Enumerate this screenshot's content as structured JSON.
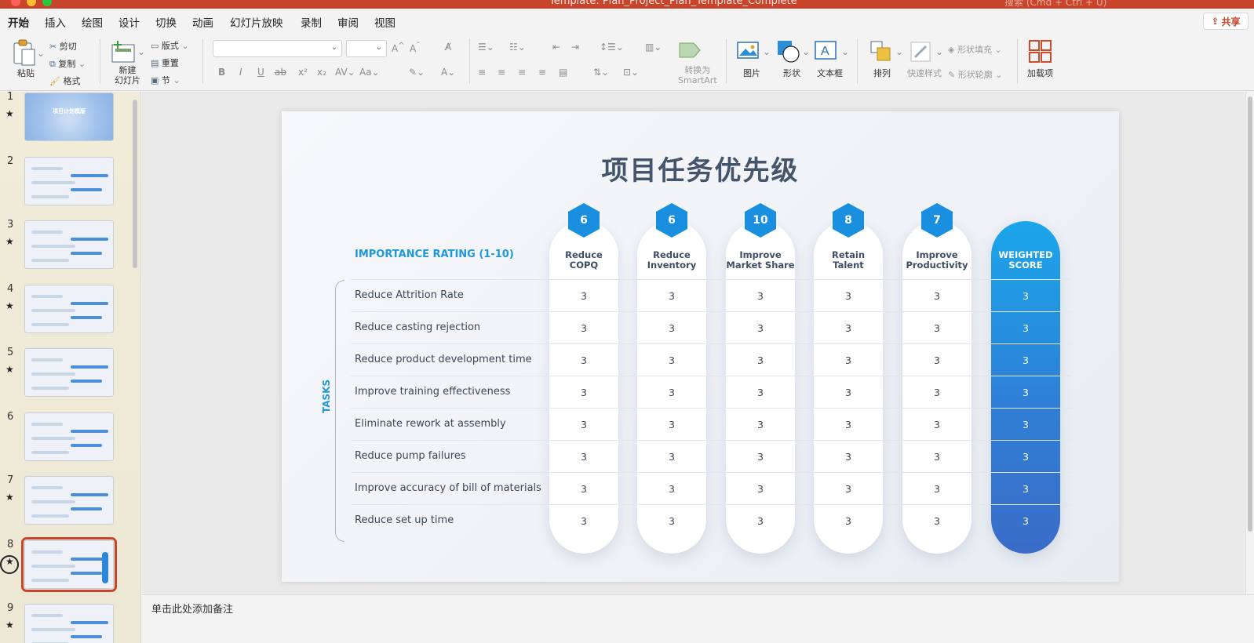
{
  "window": {
    "title": "Template: Plan_Project_Plan_Template_Complete",
    "search_placeholder": "搜索 (Cmd + Ctrl + U)"
  },
  "ribbon_tabs": [
    "开始",
    "插入",
    "绘图",
    "设计",
    "切换",
    "动画",
    "幻灯片放映",
    "录制",
    "审阅",
    "视图"
  ],
  "share_label": "共享",
  "ribbon": {
    "paste": "粘贴",
    "cut": "剪切",
    "copy": "复制",
    "format": "格式",
    "new_slide": "新建\n幻灯片",
    "layout": "版式",
    "reset": "重置",
    "section": "节",
    "convert_smartart": "转换为\nSmartArt",
    "picture": "图片",
    "shape": "形状",
    "textbox": "文本框",
    "arrange": "排列",
    "quick_styles": "快速样式",
    "shape_fill": "形状填充",
    "shape_outline": "形状轮廓",
    "addins": "加载项"
  },
  "thumbnails": [
    {
      "num": "1",
      "star": true
    },
    {
      "num": "2",
      "star": false
    },
    {
      "num": "3",
      "star": true
    },
    {
      "num": "4",
      "star": true
    },
    {
      "num": "5",
      "star": true
    },
    {
      "num": "6",
      "star": false
    },
    {
      "num": "7",
      "star": true
    },
    {
      "num": "8",
      "star": true,
      "selected": true
    },
    {
      "num": "9",
      "star": true
    }
  ],
  "thumb1_title": "项目计划模版",
  "slide": {
    "title": "项目任务优先级",
    "rating_label": "IMPORTANCE RATING (1-10)",
    "tasks_label": "TASKS",
    "columns": [
      {
        "rating": "6",
        "line1": "Reduce",
        "line2": "COPQ"
      },
      {
        "rating": "6",
        "line1": "Reduce",
        "line2": "Inventory"
      },
      {
        "rating": "10",
        "line1": "Improve",
        "line2": "Market Share"
      },
      {
        "rating": "8",
        "line1": "Retain",
        "line2": "Talent"
      },
      {
        "rating": "7",
        "line1": "Improve",
        "line2": "Productivity"
      }
    ],
    "score_header": {
      "line1": "WEIGHTED",
      "line2": "SCORE"
    },
    "tasks": [
      {
        "name": "Reduce Attrition Rate",
        "values": [
          "3",
          "3",
          "3",
          "3",
          "3"
        ],
        "score": "3"
      },
      {
        "name": "Reduce casting rejection",
        "values": [
          "3",
          "3",
          "3",
          "3",
          "3"
        ],
        "score": "3"
      },
      {
        "name": "Reduce product development time",
        "values": [
          "3",
          "3",
          "3",
          "3",
          "3"
        ],
        "score": "3"
      },
      {
        "name": "Improve training effectiveness",
        "values": [
          "3",
          "3",
          "3",
          "3",
          "3"
        ],
        "score": "3"
      },
      {
        "name": "Eliminate rework at assembly",
        "values": [
          "3",
          "3",
          "3",
          "3",
          "3"
        ],
        "score": "3"
      },
      {
        "name": "Reduce pump failures",
        "values": [
          "3",
          "3",
          "3",
          "3",
          "3"
        ],
        "score": "3"
      },
      {
        "name": "Improve accuracy of bill of materials",
        "values": [
          "3",
          "3",
          "3",
          "3",
          "3"
        ],
        "score": "3"
      },
      {
        "name": "Reduce set up time",
        "values": [
          "3",
          "3",
          "3",
          "3",
          "3"
        ],
        "score": "3"
      }
    ]
  },
  "notes_placeholder": "单击此处添加备注",
  "colors": {
    "accent": "#c8442a",
    "slide_blue": "#1e98d8",
    "title_gray": "#44546a"
  }
}
